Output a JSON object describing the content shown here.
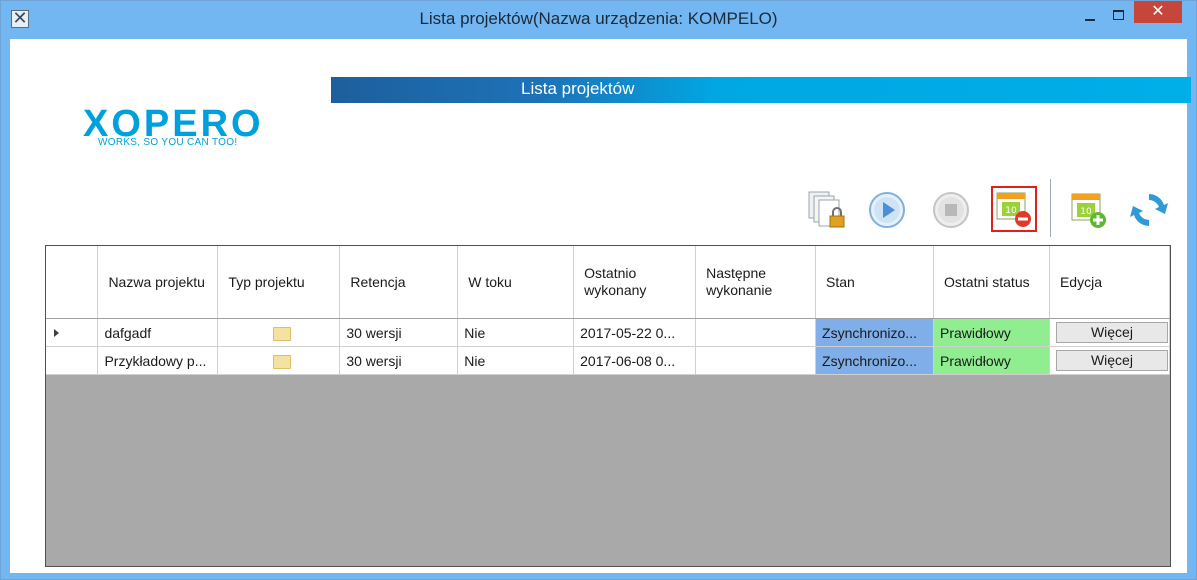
{
  "window": {
    "title": "Lista projektów(Nazwa urządzenia: KOMPELO)",
    "app_icon_glyph": "✕",
    "close_glyph": "✕",
    "accent_color": "#72b6f2",
    "close_color": "#c7463c"
  },
  "logo": {
    "word": "XOPERO",
    "tagline": "WORKS, SO YOU CAN TOO!",
    "color": "#00a0dc"
  },
  "section": {
    "title": "Lista projektów"
  },
  "toolbar": {
    "buttons": [
      {
        "icon": "lock-copy-icon"
      },
      {
        "icon": "play-icon"
      },
      {
        "icon": "stop-icon"
      },
      {
        "icon": "delete-project-icon",
        "highlighted": true
      },
      {
        "icon": "add-project-icon"
      },
      {
        "icon": "refresh-icon"
      }
    ]
  },
  "grid": {
    "columns": [
      "Nazwa projektu",
      "Typ projektu",
      "Retencja",
      "W toku",
      "Ostatnio wykonany",
      "Następne wykonanie",
      "Stan",
      "Ostatni status",
      "Edycja"
    ],
    "rows": [
      {
        "name": "dafgadf",
        "type_icon": "folder-icon",
        "retention": "30 wersji",
        "in_progress": "Nie",
        "last_run": "2017-05-22 0...",
        "next_run": "",
        "state": "Zsynchronizo...",
        "last_status": "Prawidłowy",
        "edit": "Więcej",
        "current": true
      },
      {
        "name": "Przykładowy p...",
        "type_icon": "folder-icon",
        "retention": "30 wersji",
        "in_progress": "Nie",
        "last_run": "2017-06-08 0...",
        "next_run": "",
        "state": "Zsynchronizo...",
        "last_status": "Prawidłowy",
        "edit": "Więcej",
        "current": false
      }
    ],
    "state_color": "#7faee8",
    "status_color": "#90ee90",
    "empty_area_color": "#a9a9a9"
  }
}
